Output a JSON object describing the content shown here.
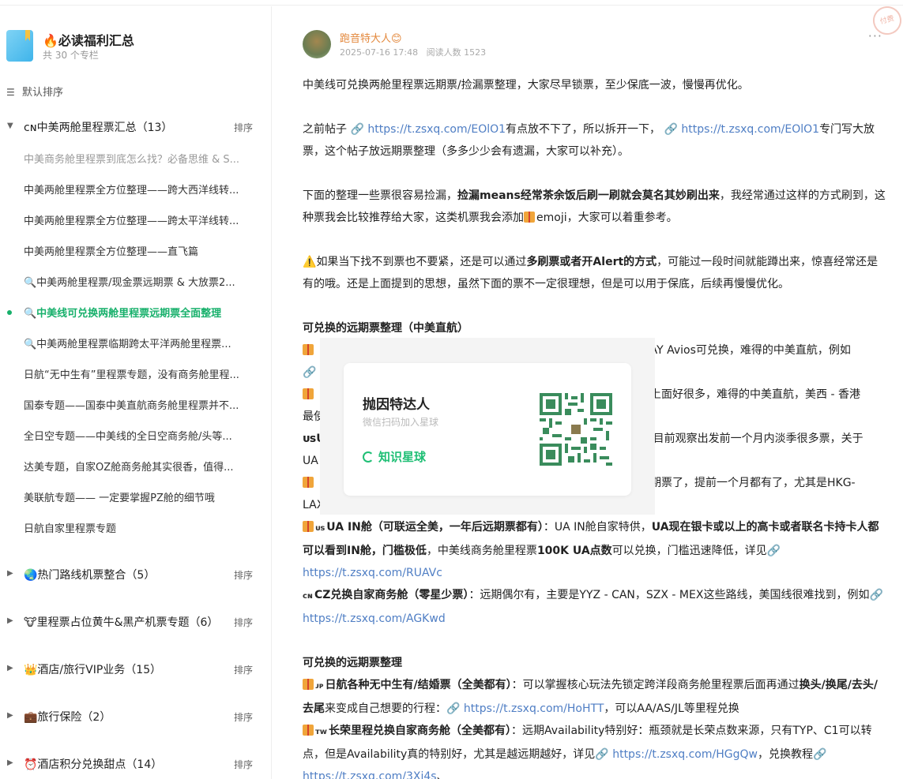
{
  "sidebar": {
    "collection_title": "🔥必读福利汇总",
    "collection_count": "共 30 个专栏",
    "sort_label": "默认排序",
    "group_sort_label": "排序",
    "groups": [
      {
        "title": "ᴄɴ中美两舱里程票汇总（13）"
      },
      {
        "title": "🌏热门路线机票整合（5）"
      },
      {
        "title": "🐮里程票占位黄牛&黑产机票专题（6）"
      },
      {
        "title": "👑酒店/旅行VIP业务（15）"
      },
      {
        "title": "💼旅行保险（2）"
      },
      {
        "title": "⏰酒店积分兑换甜点（14）"
      }
    ],
    "items": [
      "中美商务舱里程票到底怎么找？必备思维 & S...",
      "中美两舱里程票全方位整理——跨大西洋线转...",
      "中美两舱里程票全方位整理——跨太平洋线转...",
      "中美两舱里程票全方位整理——直飞篇",
      "🔍中美两舱里程票/现金票远期票 & 大放票2...",
      "🔍中美线可兑换两舱里程票远期票全面整理",
      "🔍中美两舱里程票临期跨太平洋两舱里程票...",
      "日航“无中生有”里程票专题，没有商务舱里程...",
      "国泰专题——国泰中美直航商务舱里程票并不...",
      "全日空专题——中美线的全日空商务舱/头等...",
      "达美专题，自家OZ舱商务舱其实很香，值得...",
      "美联航专题—— 一定要掌握PZ舱的细节哦",
      "日航自家里程票专题"
    ]
  },
  "post": {
    "author": "跑音特大人😊",
    "date": "2025-07-16 17:48",
    "reads": "阅读人数 1523",
    "more": "···",
    "stamp": "付费",
    "p1": "中美线可兑换两舱里程票远期票/捡漏票整理，大家尽早锁票，至少保底一波，慢慢再优化。",
    "p2_a": "之前帖子 ",
    "p2_link1": "https://t.zsxq.com/EOlO1",
    "p2_b": "有点放不下了，所以拆开一下，",
    "p2_link2": "https://t.zsxq.com/EOlO1",
    "p2_c": "专门写大放票，这个帖子放远期票整理（多多少少会有遗漏，大家可以补充）。",
    "p3_a": "下面的整理一些票很容易捡漏，",
    "p3_bold": "捡漏means经常茶余饭后刷一刷就会莫名其妙刷出来",
    "p3_b": "，我经常通过这样的方式刷到，这种票我会比较推荐给大家，这类机票我会添加",
    "p3_c": "emoji，大家可以着重参考。",
    "p4_warn": "⚠️",
    "p4_a": "如果当下找不到票也不要紧，还是可以通过",
    "p4_bold": "多刷票或者开Alert的方式",
    "p4_b": "，可能过一段时间就能蹲出来，惊喜经常还是有的哦。还是上面提到的思想，虽然下面的票不一定很理想，但是可以用于保底，后续再慢慢优化。",
    "h1": "可兑换的远期票整理（中美直航）",
    "l1_tail": "K AY Avios可兑换，难得的中美直航，例如",
    "l2_tail": "么上面好很多，难得的中美直航，美西 - 香港",
    "l2_cont": "最使",
    "l3_head": "ᴜsU",
    "l3_tail": "目前观察出发前一个月内淡季很多票，关于",
    "l3_cont": "UA",
    "l4_tail": "远期票了，提前一个月都有了，尤其是HKG-",
    "l4_cont": "LAX",
    "l5_flag": "ᴜs",
    "l5_bold": "UA IN舱（可联运全美，一年后远期票都有）",
    "l5_a": "：UA IN舱自家特供，",
    "l5_bold2": "UA现在银卡或以上的高卡或者联名卡持卡人都可以看到IN舱，门槛极低",
    "l5_b": "，中美线商务舱里程票",
    "l5_bold3": "100K UA点数",
    "l5_c": "可以兑换，门槛迅速降低，详见",
    "l5_link": "https://t.zsxq.com/RUAVc",
    "l6_flag": "ᴄɴ",
    "l6_bold": "CZ兑换自家商务舱（零星少票）",
    "l6_a": "：远期偶尔有，主要是YYZ - CAN，SZX - MEX这些路线，美国线很难找到，例如",
    "l6_link": "https://t.zsxq.com/AGKwd",
    "h2": "可兑换的远期票整理",
    "l7_flag": "ᴊᴘ",
    "l7_bold": "日航各种无中生有/结婚票（全美都有）",
    "l7_a": "：可以掌握核心玩法先锁定跨洋段商务舱里程票后面再通过",
    "l7_bold2": "换头/换尾/去头/去尾",
    "l7_b": "来变成自己想要的行程：",
    "l7_link": "https://t.zsxq.com/HoHTT",
    "l7_c": "，可以AA/AS/JL等里程兑换",
    "l8_flag": "ᴛᴡ",
    "l8_bold": "长荣里程兑换自家商务舱（全美都有）",
    "l8_a": "：远期Availability特别好：瓶颈就是长荣点数来源，只有TYP、C1可以转点，但是Availability真的特别好，尤其是越远期越好，详见",
    "l8_link1": "https://t.zsxq.com/HGgQw",
    "l8_b": "，兑换教程",
    "l8_link2": "https://t.zsxq.com/3Xi4s",
    "l8_c": "、"
  },
  "popup": {
    "name": "抛因特达人",
    "hint": "微信扫码加入星球",
    "brand": "知识星球"
  },
  "colors": {
    "accent": "#17b06b",
    "link": "#4f7ec4",
    "author": "#e3883c"
  }
}
